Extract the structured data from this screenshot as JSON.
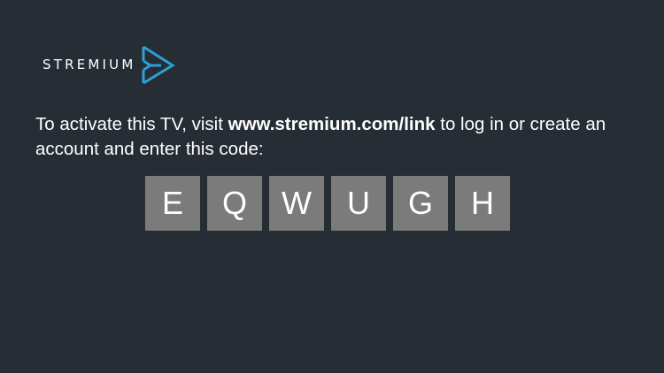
{
  "brand": {
    "name": "STREMIUM",
    "accent_color": "#2d9fd5",
    "logo_icon": "play-triangle-icon"
  },
  "instructions": {
    "prefix": "To activate this TV, visit ",
    "link": "www.stremium.com/link",
    "suffix": " to log in or create an account and enter this code:"
  },
  "code": {
    "characters": [
      "E",
      "Q",
      "W",
      "U",
      "G",
      "H"
    ],
    "tile_color": "#7b7b7b"
  },
  "background_color": "#272d35"
}
